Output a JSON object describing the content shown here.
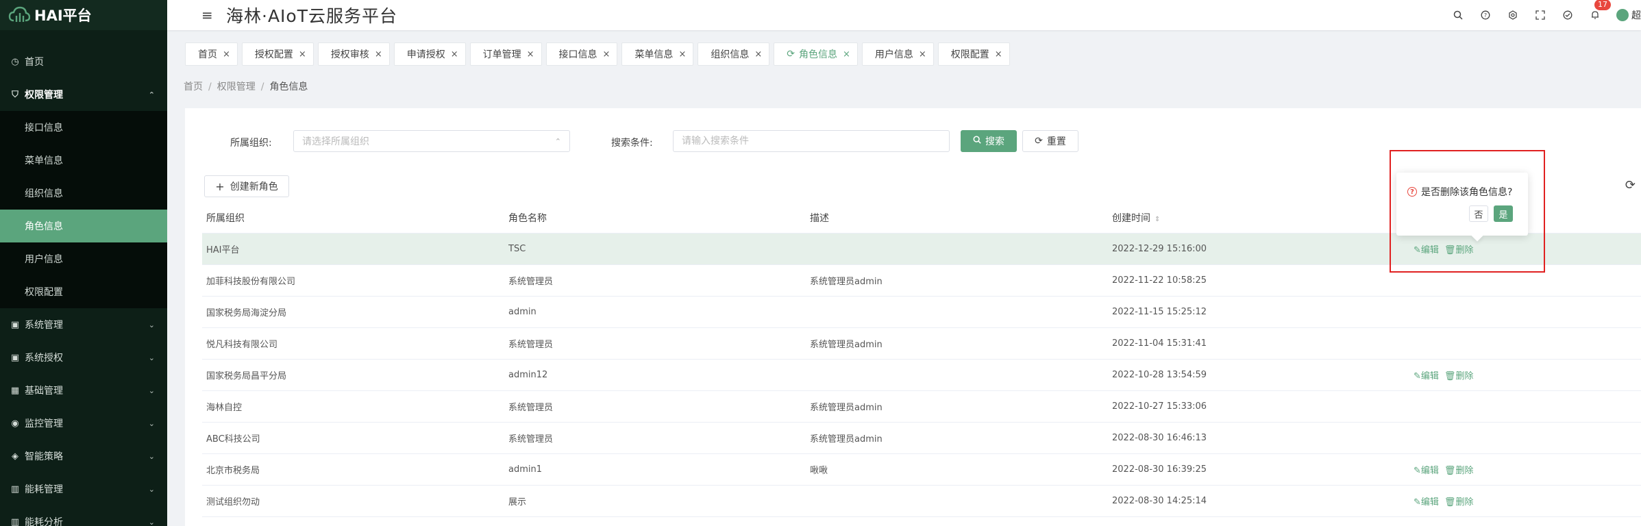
{
  "brand": {
    "name": "HAI平台"
  },
  "sidebar": {
    "items": [
      {
        "label": "首页",
        "icon": "clock-icon"
      },
      {
        "label": "权限管理",
        "icon": "shield-icon",
        "open": true,
        "children": [
          {
            "label": "接口信息"
          },
          {
            "label": "菜单信息"
          },
          {
            "label": "组织信息"
          },
          {
            "label": "角色信息",
            "active": true
          },
          {
            "label": "用户信息"
          },
          {
            "label": "权限配置"
          }
        ]
      },
      {
        "label": "系统管理",
        "icon": "monitor-icon"
      },
      {
        "label": "系统授权",
        "icon": "monitor-icon"
      },
      {
        "label": "基础管理",
        "icon": "grid-icon"
      },
      {
        "label": "监控管理",
        "icon": "camera-icon"
      },
      {
        "label": "智能策略",
        "icon": "bulb-icon"
      },
      {
        "label": "能耗管理",
        "icon": "chart-icon"
      },
      {
        "label": "能耗分析",
        "icon": "chart-icon"
      }
    ]
  },
  "header": {
    "title": "海林·AIoT云服务平台",
    "notification_count": "17",
    "user_name": "超"
  },
  "tabs": [
    {
      "label": "首页"
    },
    {
      "label": "授权配置"
    },
    {
      "label": "授权审核"
    },
    {
      "label": "申请授权"
    },
    {
      "label": "订单管理"
    },
    {
      "label": "接口信息"
    },
    {
      "label": "菜单信息"
    },
    {
      "label": "组织信息"
    },
    {
      "label": "角色信息",
      "active": true
    },
    {
      "label": "用户信息"
    },
    {
      "label": "权限配置"
    }
  ],
  "breadcrumb": {
    "items": [
      "首页",
      "权限管理",
      "角色信息"
    ]
  },
  "search": {
    "org_label": "所属组织:",
    "org_placeholder": "请选择所属组织",
    "cond_label": "搜索条件:",
    "cond_placeholder": "请输入搜索条件",
    "search_label": "搜索",
    "reset_label": "重置"
  },
  "create_label": "创建新角色",
  "table": {
    "headers": [
      "所属组织",
      "角色名称",
      "描述",
      "创建时间"
    ],
    "rows": [
      {
        "org": "HAI平台",
        "role": "TSC",
        "desc": "",
        "time": "2022-12-29 15:16:00",
        "ops": true,
        "highlight": true
      },
      {
        "org": "加菲科技股份有限公司",
        "role": "系统管理员",
        "desc": "系统管理员admin",
        "time": "2022-11-22 10:58:25",
        "ops": false
      },
      {
        "org": "国家税务局海淀分局",
        "role": "admin",
        "desc": "",
        "time": "2022-11-15 15:25:12",
        "ops": false
      },
      {
        "org": "悦凡科技有限公司",
        "role": "系统管理员",
        "desc": "系统管理员admin",
        "time": "2022-11-04 15:31:41",
        "ops": false
      },
      {
        "org": "国家税务局昌平分局",
        "role": "admin12",
        "desc": "",
        "time": "2022-10-28 13:54:59",
        "ops": true
      },
      {
        "org": "海林自控",
        "role": "系统管理员",
        "desc": "系统管理员admin",
        "time": "2022-10-27 15:33:06",
        "ops": false
      },
      {
        "org": "ABC科技公司",
        "role": "系统管理员",
        "desc": "系统管理员admin",
        "time": "2022-08-30 16:46:13",
        "ops": false
      },
      {
        "org": "北京市税务局",
        "role": "admin1",
        "desc": "啾啾",
        "time": "2022-08-30 16:39:25",
        "ops": true
      },
      {
        "org": "测试组织勿动",
        "role": "展示",
        "desc": "",
        "time": "2022-08-30 14:25:14",
        "ops": true
      }
    ],
    "edit_label": "编辑",
    "delete_label": "删除"
  },
  "popconfirm": {
    "question": "是否删除该角色信息?",
    "no_label": "否",
    "yes_label": "是"
  },
  "colors": {
    "accent": "#5ba57d",
    "sidebar_bg": "#0d1f17",
    "danger": "#e02020"
  }
}
